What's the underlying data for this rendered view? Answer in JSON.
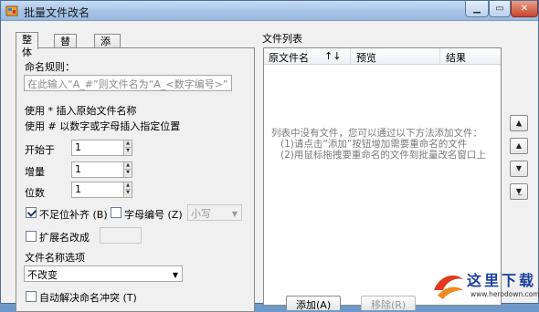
{
  "window": {
    "title": "批量文件改名"
  },
  "tabs": [
    "整体",
    "替换",
    "添加/删除"
  ],
  "rule": {
    "label": "命名规则：",
    "placeholder": "在此输入“A_#”则文件名为“A_<数字编号>”"
  },
  "hints": [
    "使用 * 插入原始文件名称",
    "使用 # 以数字或字母插入指定位置"
  ],
  "fields": [
    {
      "label": "开始于",
      "value": "1"
    },
    {
      "label": "增量",
      "value": "1"
    },
    {
      "label": "位数",
      "value": "1"
    }
  ],
  "options": {
    "pad": {
      "label": "不足位补齐 (B)",
      "checked": true
    },
    "letter": {
      "label": "字母编号 (Z)",
      "checked": false
    },
    "case_select": "小写",
    "ext": {
      "label": "扩展名改成",
      "checked": false
    },
    "name_options_label": "文件名称选项",
    "name_option_value": "不改变",
    "auto_conflict": {
      "label": "自动解决命名冲突 (T)",
      "checked": false
    }
  },
  "file_list": {
    "title": "文件列表",
    "columns": [
      "原文件名",
      "↑↓",
      "预览",
      "结果"
    ],
    "empty_lines": [
      "列表中没有文件，您可以通过以下方法添加文件：",
      "(1)请点击“添加”按钮增加需要重命名的文件",
      "(2)用鼠标拖拽要重命名的文件到批量改名窗口上"
    ]
  },
  "side_buttons": [
    "move-top",
    "move-up",
    "move-down",
    "move-bottom"
  ],
  "bottom_buttons": [
    "添加(A)",
    "移除(R)"
  ],
  "watermark": {
    "text": "这里下载",
    "url": "www.herodown.com"
  }
}
